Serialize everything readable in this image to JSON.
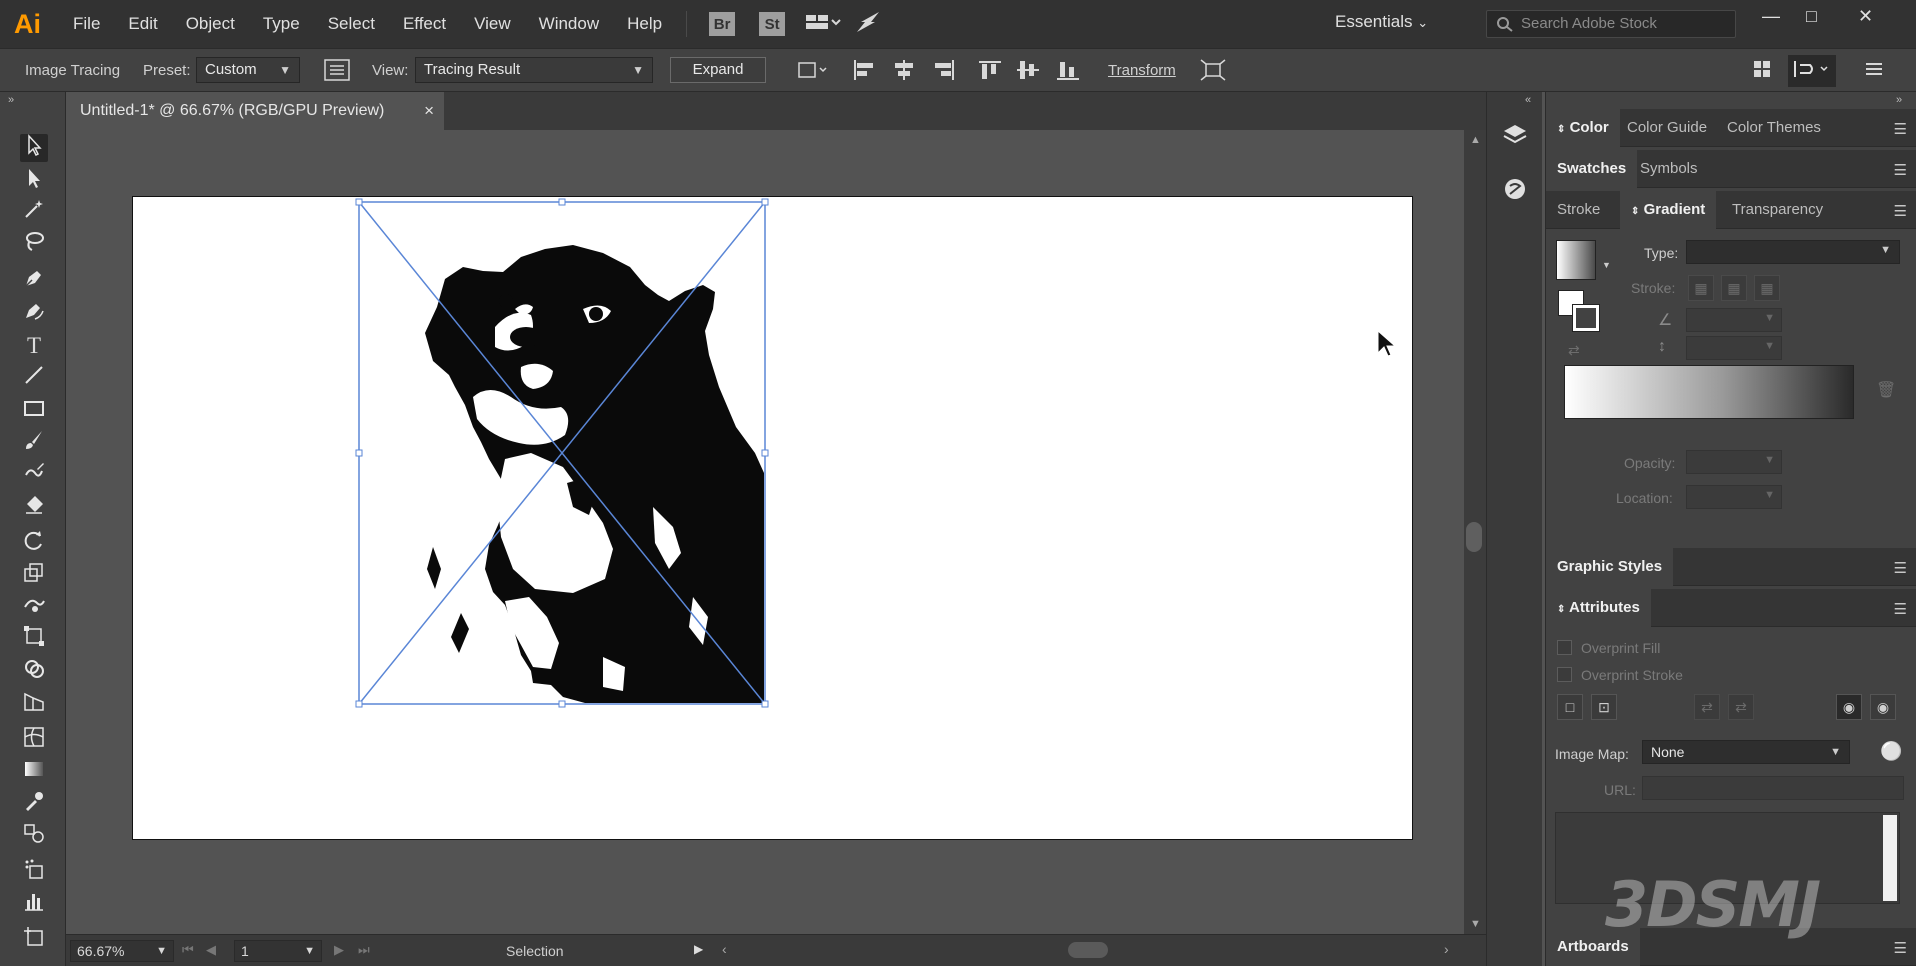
{
  "app": {
    "logo": "Ai"
  },
  "menu": [
    "File",
    "Edit",
    "Object",
    "Type",
    "Select",
    "Effect",
    "View",
    "Window",
    "Help"
  ],
  "app_buttons": {
    "bridge": "Br",
    "stock": "St"
  },
  "workspace": {
    "label": "Essentials"
  },
  "search": {
    "placeholder": "Search Adobe Stock"
  },
  "controlbar": {
    "panel_label": "Image Tracing",
    "preset_label": "Preset:",
    "preset_value": "Custom",
    "view_label": "View:",
    "view_value": "Tracing Result",
    "expand_label": "Expand",
    "transform_label": "Transform"
  },
  "document": {
    "tab_title": "Untitled-1* @ 66.67% (RGB/GPU Preview)",
    "close_glyph": "×"
  },
  "statusbar": {
    "zoom": "66.67%",
    "artboard": "1",
    "tool": "Selection"
  },
  "panels": {
    "color_tabs": [
      "Color",
      "Color Guide",
      "Color Themes"
    ],
    "swatch_tabs": [
      "Swatches",
      "Symbols"
    ],
    "gradient_tabs": [
      "Stroke",
      "Gradient",
      "Transparency"
    ],
    "gradient": {
      "type_label": "Type:",
      "stroke_label": "Stroke:",
      "opacity_label": "Opacity:",
      "location_label": "Location:"
    },
    "graphic_styles_tab": "Graphic Styles",
    "attributes": {
      "tab": "Attributes",
      "overprint_fill": "Overprint Fill",
      "overprint_stroke": "Overprint Stroke",
      "image_map_label": "Image Map:",
      "image_map_value": "None",
      "url_label": "URL:"
    },
    "artboards_tab": "Artboards"
  },
  "watermark": "3DSMJ",
  "colors": {
    "accent": "#ff9a00",
    "selection": "#4a7ee0",
    "ui_dark": "#323232",
    "ui_panel": "#424242"
  }
}
